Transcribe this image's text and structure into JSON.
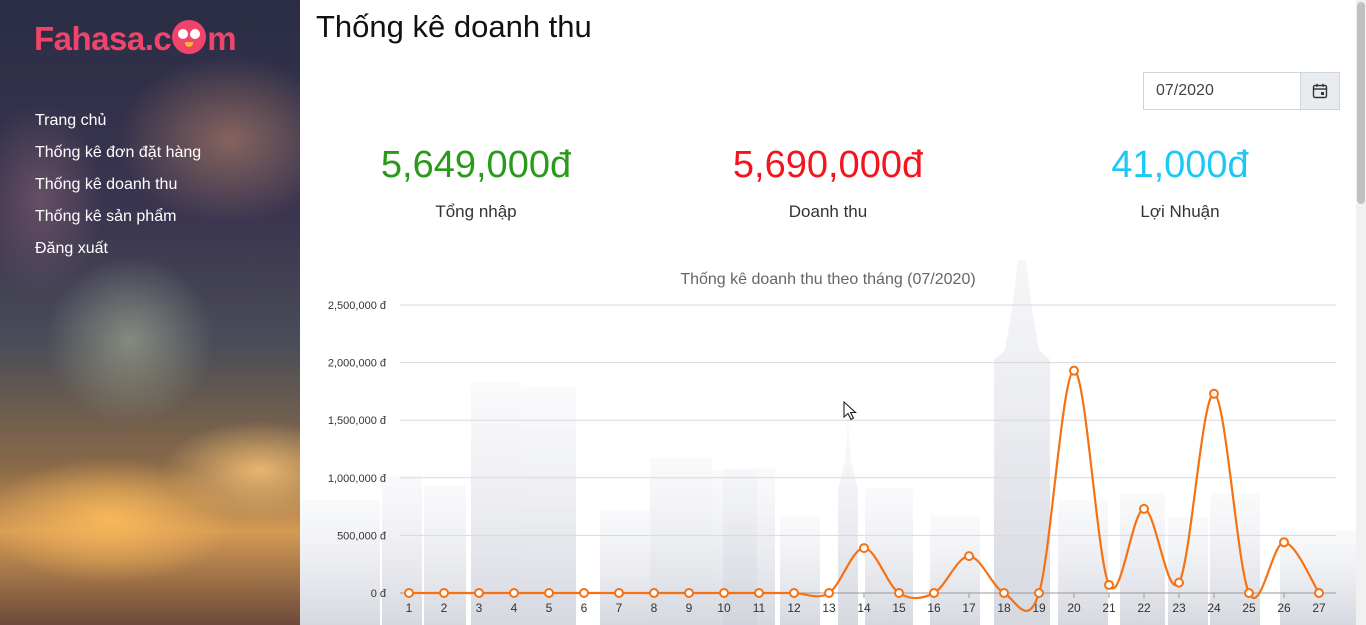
{
  "brand": {
    "logo_text_prefix": "Fahasa.c",
    "logo_text_suffix": "m",
    "logo_color": "#f0446a"
  },
  "sidebar": {
    "items": [
      {
        "label": "Trang chủ"
      },
      {
        "label": "Thống kê đơn đặt hàng"
      },
      {
        "label": "Thống kê doanh thu"
      },
      {
        "label": "Thống kê sản phẩm"
      },
      {
        "label": "Đăng xuất"
      }
    ]
  },
  "page": {
    "title": "Thống kê doanh thu"
  },
  "month_picker": {
    "value": "07/2020",
    "icon": "calendar-icon"
  },
  "stats": [
    {
      "value": "5,649,000đ",
      "label": "Tổng nhập",
      "color": "#2a9a1a"
    },
    {
      "value": "5,690,000đ",
      "label": "Doanh thu",
      "color": "#f5141e"
    },
    {
      "value": "41,000đ",
      "label": "Lợi Nhuận",
      "color": "#1ec8f5"
    }
  ],
  "chart_data": {
    "type": "line",
    "title": "Thống kê doanh thu theo tháng (07/2020)",
    "x": [
      1,
      2,
      3,
      4,
      5,
      6,
      7,
      8,
      9,
      10,
      11,
      12,
      13,
      14,
      15,
      16,
      17,
      18,
      19,
      20,
      21,
      22,
      23,
      24,
      25,
      26,
      27
    ],
    "values": [
      0,
      0,
      0,
      0,
      0,
      0,
      0,
      0,
      0,
      0,
      0,
      0,
      0,
      390000,
      0,
      0,
      320000,
      0,
      0,
      1930000,
      70000,
      730000,
      90000,
      1730000,
      0,
      440000,
      0
    ],
    "ylim": [
      0,
      2500000
    ],
    "yticks": [
      "0 đ",
      "500,000 đ",
      "1,000,000 đ",
      "1,500,000 đ",
      "2,000,000 đ",
      "2,500,000 đ"
    ],
    "ytick_values": [
      0,
      500000,
      1000000,
      1500000,
      2000000,
      2500000
    ],
    "grid": true,
    "line_color": "#f57214",
    "xlabel": "",
    "ylabel": ""
  }
}
